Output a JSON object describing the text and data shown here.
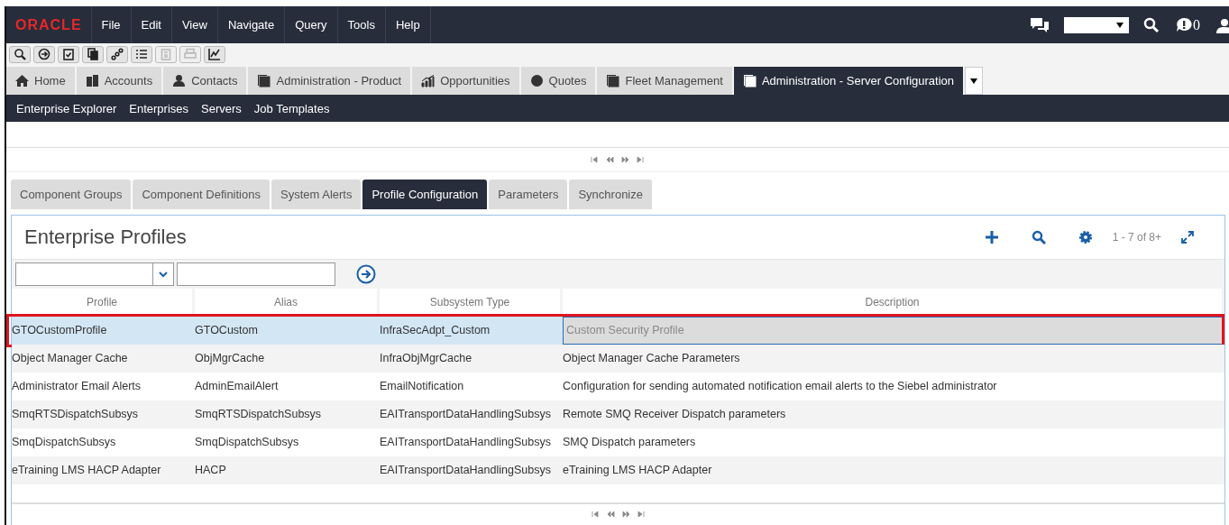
{
  "menu_bar": {
    "logo": "ORACLE",
    "items": [
      "File",
      "Edit",
      "View",
      "Navigate",
      "Query",
      "Tools",
      "Help"
    ],
    "notification_count": "0"
  },
  "toolbar": [
    {
      "kind": "search",
      "disabled": false
    },
    {
      "kind": "go",
      "disabled": false
    },
    {
      "kind": "checklist",
      "disabled": false
    },
    {
      "kind": "copy",
      "disabled": false
    },
    {
      "kind": "link",
      "disabled": false
    },
    {
      "kind": "list",
      "disabled": false
    },
    {
      "kind": "clipboard",
      "disabled": true
    },
    {
      "kind": "print",
      "disabled": true
    },
    {
      "kind": "chart",
      "disabled": false
    }
  ],
  "screen_tabs": [
    {
      "label": "Home",
      "kind": "home",
      "selected": false
    },
    {
      "label": "Accounts",
      "kind": "building",
      "selected": false
    },
    {
      "label": "Contacts",
      "kind": "person",
      "selected": false
    },
    {
      "label": "Administration - Product",
      "kind": "page",
      "selected": false
    },
    {
      "label": "Opportunities",
      "kind": "chart",
      "selected": false
    },
    {
      "label": "Quotes",
      "kind": "quote",
      "selected": false
    },
    {
      "label": "Fleet Management",
      "kind": "page",
      "selected": false
    },
    {
      "label": "Administration - Server Configuration",
      "kind": "page",
      "selected": true
    }
  ],
  "sub_nav": [
    "Enterprise Explorer",
    "Enterprises",
    "Servers",
    "Job Templates"
  ],
  "view_tabs": [
    {
      "label": "Component Groups",
      "selected": false
    },
    {
      "label": "Component Definitions",
      "selected": false
    },
    {
      "label": "System Alerts",
      "selected": false
    },
    {
      "label": "Profile Configuration",
      "selected": true
    },
    {
      "label": "Parameters",
      "selected": false
    },
    {
      "label": "Synchronize",
      "selected": false
    }
  ],
  "applet": {
    "title": "Enterprise Profiles",
    "record_count": "1 - 7 of 8+",
    "columns": [
      "Profile",
      "Alias",
      "Subsystem Type",
      "Description"
    ],
    "rows": [
      {
        "selected": true,
        "highlighted": true,
        "cells": [
          "GTOCustomProfile",
          "GTOCustom",
          "InfraSecAdpt_Custom",
          "Custom Security Profile"
        ]
      },
      {
        "selected": false,
        "highlighted": false,
        "cells": [
          "Object Manager Cache",
          "ObjMgrCache",
          "InfraObjMgrCache",
          "Object Manager Cache Parameters"
        ]
      },
      {
        "selected": false,
        "highlighted": false,
        "cells": [
          "Administrator Email Alerts",
          "AdminEmailAlert",
          "EmailNotification",
          "Configuration for sending automated notification email alerts to the Siebel administrator"
        ]
      },
      {
        "selected": false,
        "highlighted": false,
        "cells": [
          "SmqRTSDispatchSubsys",
          "SmqRTSDispatchSubsys",
          "EAITransportDataHandlingSubsys",
          "Remote SMQ Receiver Dispatch parameters"
        ]
      },
      {
        "selected": false,
        "highlighted": false,
        "cells": [
          "SmqDispatchSubsys",
          "SmqDispatchSubsys",
          "EAITransportDataHandlingSubsys",
          "SMQ Dispatch parameters"
        ]
      },
      {
        "selected": false,
        "highlighted": false,
        "cells": [
          "eTraining LMS HACP Adapter",
          "HACP",
          "EAITransportDataHandlingSubsys",
          "eTraining LMS HACP Adapter"
        ]
      }
    ]
  }
}
